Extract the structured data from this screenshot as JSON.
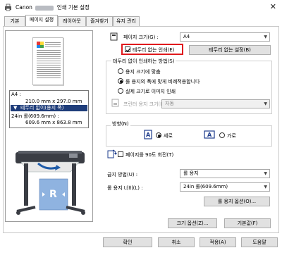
{
  "window": {
    "title_prefix": "Canon",
    "title_suffix": "인쇄 기본 설정",
    "close_icon": "close-icon"
  },
  "tabs": [
    {
      "label": "기본"
    },
    {
      "label": "페이지 설정"
    },
    {
      "label": "레이아웃"
    },
    {
      "label": "즐겨찾기"
    },
    {
      "label": "유지 관리"
    }
  ],
  "preview": {
    "size_label": "A4 :",
    "size_dims": "210.0 mm x 297.0 mm",
    "banner": "테두리 없이(용지 폭)",
    "roll_label": "24in 롤(609.6mm) :",
    "roll_dims": "609.6 mm x 863.8 mm",
    "accent": "#1f3d7a"
  },
  "page_size": {
    "label": "페이지 크기(G) :",
    "value": "A4"
  },
  "borderless": {
    "label": "테두리 없는 인쇄(E)",
    "settings_button": "테두리 없는 설정(B)"
  },
  "method_group": {
    "title": "테두리 없이 인쇄하는 방법(S)",
    "options": [
      {
        "label": "용지 크기에 맞춤",
        "selected": false
      },
      {
        "label": "롤 용지의 폭에 맞게 비례적용합니다",
        "selected": true
      },
      {
        "label": "실제 크기로 이미지 인쇄",
        "selected": false
      }
    ],
    "printer_paper_label": "프린터 용지 크기(I) :",
    "printer_paper_value": "자동"
  },
  "orientation": {
    "title": "방향(N)",
    "portrait": "세로",
    "landscape": "가로",
    "selected": "portrait"
  },
  "rotate": {
    "label": "페이지를 90도 회전(T)"
  },
  "feed": {
    "label": "급지 방법(U) :",
    "value": "롤 용지"
  },
  "roll_width": {
    "label": "롤 용지 너비(L) :",
    "value": "24in 롤(609.6mm)"
  },
  "roll_options_button": "롤 용지 옵션(O)...",
  "size_options_button": "크기 옵션(Z)...",
  "defaults_button": "기본값(F)",
  "footer": {
    "ok": "확인",
    "cancel": "취소",
    "apply": "적용(A)",
    "help": "도움말"
  }
}
